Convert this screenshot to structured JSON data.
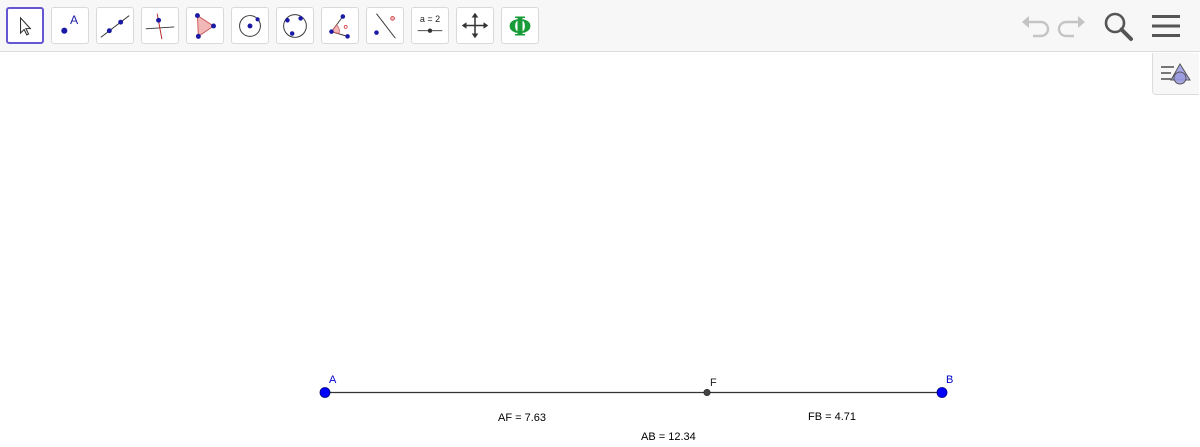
{
  "toolbar": {
    "tools": [
      {
        "name": "move-tool"
      },
      {
        "name": "point-tool",
        "glyph": "A"
      },
      {
        "name": "line-tool"
      },
      {
        "name": "perpendicular-line-tool"
      },
      {
        "name": "polygon-tool"
      },
      {
        "name": "circle-center-point-tool"
      },
      {
        "name": "circle-three-points-tool"
      },
      {
        "name": "angle-tool"
      },
      {
        "name": "reflect-about-line-tool"
      },
      {
        "name": "slider-tool",
        "glyph": "a = 2"
      },
      {
        "name": "move-graphics-view-tool"
      },
      {
        "name": "custom-phi-tool",
        "glyph": "Φ"
      }
    ],
    "right_icons": [
      "undo-icon",
      "redo-icon",
      "search-icon",
      "menu-icon"
    ]
  },
  "colors": {
    "accent": "#6557d2",
    "point_blue": "#0000ff",
    "point_dark": "#444444",
    "label_blue": "#0000cc",
    "segment": "#333333",
    "phi_green": "#1a9b3a"
  },
  "canvas": {
    "points": {
      "A": {
        "label": "A"
      },
      "F": {
        "label": "F"
      },
      "B": {
        "label": "B"
      }
    },
    "measurements": {
      "AF": "AF = 7.63",
      "FB": "FB = 4.71",
      "AB": "AB = 12.34"
    }
  }
}
